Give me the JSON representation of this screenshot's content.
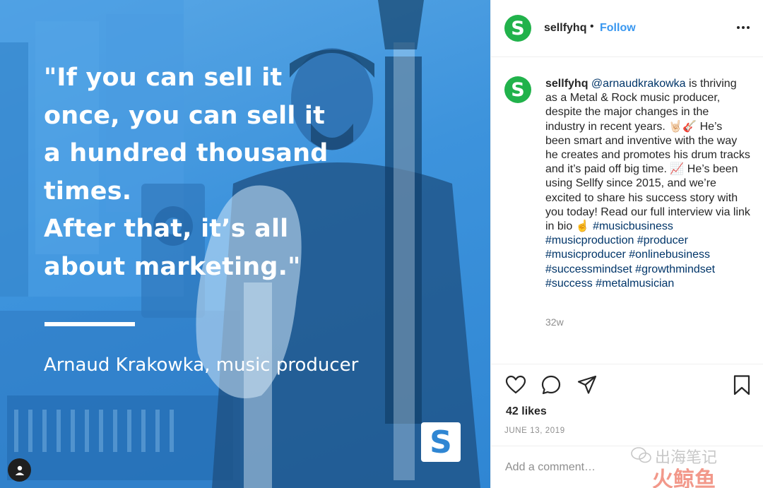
{
  "media": {
    "quote_lines": [
      "\"If you can sell it",
      "once, you can sell it",
      "a hundred thousand",
      "times.",
      "After that, it’s all",
      "about marketing.\""
    ],
    "author": "Arnaud Krakowka, music producer",
    "brand_mark": "S"
  },
  "header": {
    "avatar_letter": "S",
    "username": "sellfyhq",
    "separator": "•",
    "follow_label": "Follow"
  },
  "caption": {
    "avatar_letter": "S",
    "username": "sellfyhq",
    "mention": "@arnaudkrakowka",
    "text_1": " is thriving as a Metal & Rock music producer, despite the major changes in the industry in recent years. 🤘🏻🎸 He’s been smart and inventive with the way he creates and promotes his drum tracks and it’s paid off big time. 📈 He’s been using Sellfy since 2015, and we’re excited to share his success story with you today! Read our full interview via link in bio ☝️",
    "hashtags": [
      "#musicbusiness",
      "#musicproduction",
      "#producer",
      "#musicproducer",
      "#onlinebusiness",
      "#successmindset",
      "#growthmindset",
      "#success",
      "#metalmusician"
    ],
    "time": "32w"
  },
  "actions": {
    "like_icon": "heart-icon",
    "comment_icon": "comment-icon",
    "share_icon": "share-icon",
    "save_icon": "bookmark-icon",
    "likes": "42 likes",
    "date": "JUNE 13, 2019"
  },
  "add_comment": {
    "placeholder": "Add a comment…"
  },
  "watermark": {
    "line1": "出海笔记",
    "line2": "火鲸鱼"
  },
  "colors": {
    "media_blue": "#3d93dc",
    "brand_green": "#21b24b",
    "follow_blue": "#3897f0",
    "hashtag_blue": "#003569",
    "muted_gray": "#8e8e8e"
  }
}
